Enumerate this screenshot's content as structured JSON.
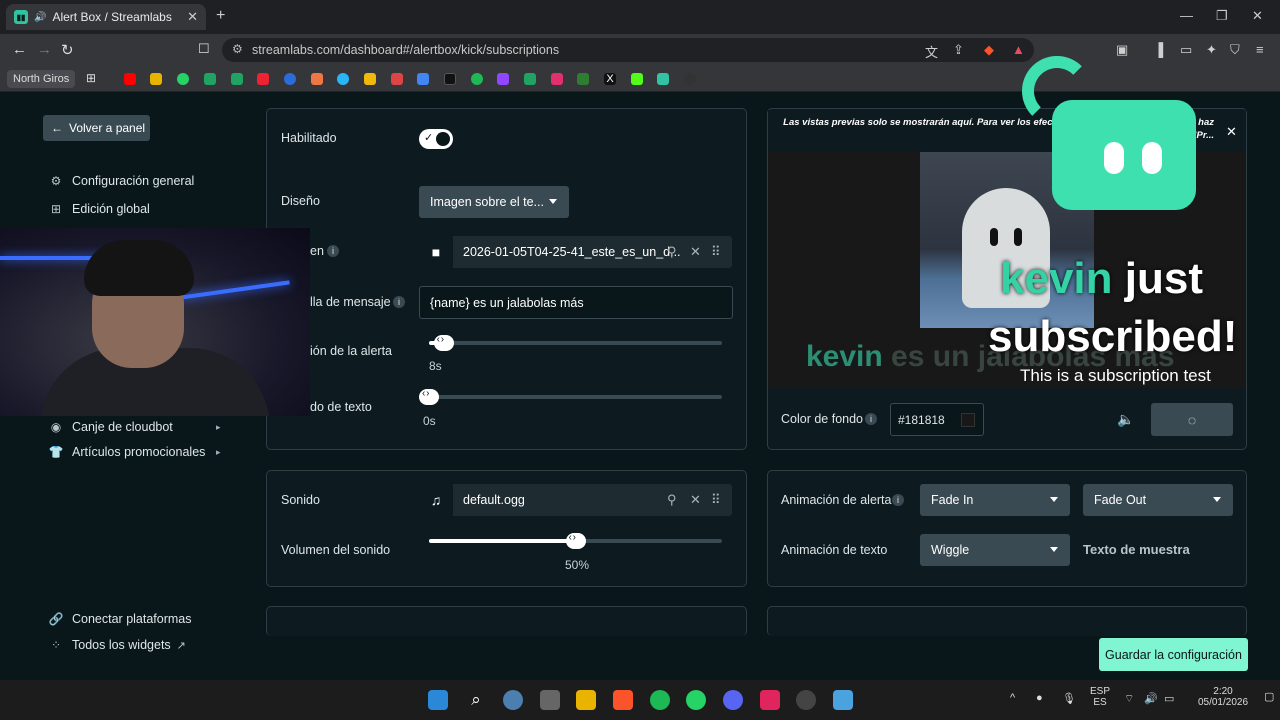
{
  "browser": {
    "tab_title": "Alert Box / Streamlabs",
    "url": "streamlabs.com/dashboard#/alertbox/kick/subscriptions",
    "bookmark_folder": "North Giros"
  },
  "sidebar": {
    "back_label": "Volver a panel",
    "items": [
      {
        "label": "Configuración general",
        "icon": "gear-icon"
      },
      {
        "label": "Edición global",
        "icon": "grid-icon"
      },
      {
        "label": "Canje de cloudbot",
        "icon": "chat-icon"
      },
      {
        "label": "Artículos promocionales",
        "icon": "shirt-icon"
      }
    ],
    "bottom": [
      {
        "label": "Conectar plataformas",
        "icon": "link-icon"
      },
      {
        "label": "Todos los widgets",
        "icon": "widgets-icon"
      }
    ]
  },
  "settings": {
    "enabled_label": "Habilitado",
    "design_label": "Diseño",
    "design_value": "Imagen sobre el te...",
    "image_label": "en",
    "image_file": "2026-01-05T04-25-41_este_es_un_d...",
    "message_label": "lla de mensaje",
    "message_value": "{name} es un jalabolas más",
    "duration_label": "ión de la alerta",
    "duration_value": "8s",
    "duration_level": 0.05,
    "text_delay_label": "do de texto",
    "text_delay_value": "0s",
    "text_delay_level": 0.0
  },
  "sound": {
    "sound_label": "Sonido",
    "sound_file": "default.ogg",
    "volume_label": "Volumen del sonido",
    "volume_value": "50%",
    "volume_level": 0.5
  },
  "preview": {
    "notice": "Las vistas previas solo se mostrarán aquí. Para ver los efectos… guarda tu configuración y haz clic en el botón \"Pr...",
    "caption_name": "kevin",
    "caption_rest": " es un jalabolas más",
    "big_name": "kevin",
    "big_rest": " just",
    "big_line2": "subscribed!",
    "subtext": "This is a subscription test",
    "bg_label": "Color de fondo",
    "bg_value": "#181818"
  },
  "animation": {
    "alert_label": "Animación de alerta",
    "alert_in": "Fade In",
    "alert_out": "Fade Out",
    "text_label": "Animación de texto",
    "text_value": "Wiggle",
    "sample_text": "Texto de muestra"
  },
  "save_label": "Guardar la configuración",
  "taskbar": {
    "lang1": "ESP",
    "lang2": "ES",
    "time": "2:20",
    "date": "05/01/2026"
  }
}
